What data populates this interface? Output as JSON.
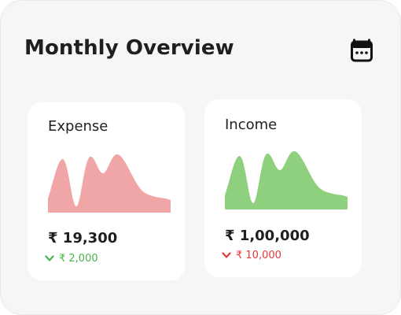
{
  "header": {
    "title": "Monthly Overview",
    "calendar_icon": "calendar-icon"
  },
  "cards": {
    "expense": {
      "title": "Expense",
      "amount": "₹ 19,300",
      "delta": "₹ 2,000",
      "delta_icon": "chevron-down-icon",
      "chart_color": "#f0a6a6",
      "delta_color": "#47b34c"
    },
    "income": {
      "title": "Income",
      "amount": "₹ 1,00,000",
      "delta": "₹ 10,000",
      "delta_icon": "chevron-down-icon",
      "chart_color": "#8fd07f",
      "delta_color": "#e03a3a"
    }
  },
  "colors": {
    "panel_bg": "#f6f6f6",
    "card_bg": "#ffffff",
    "text": "#1f1f1f"
  }
}
